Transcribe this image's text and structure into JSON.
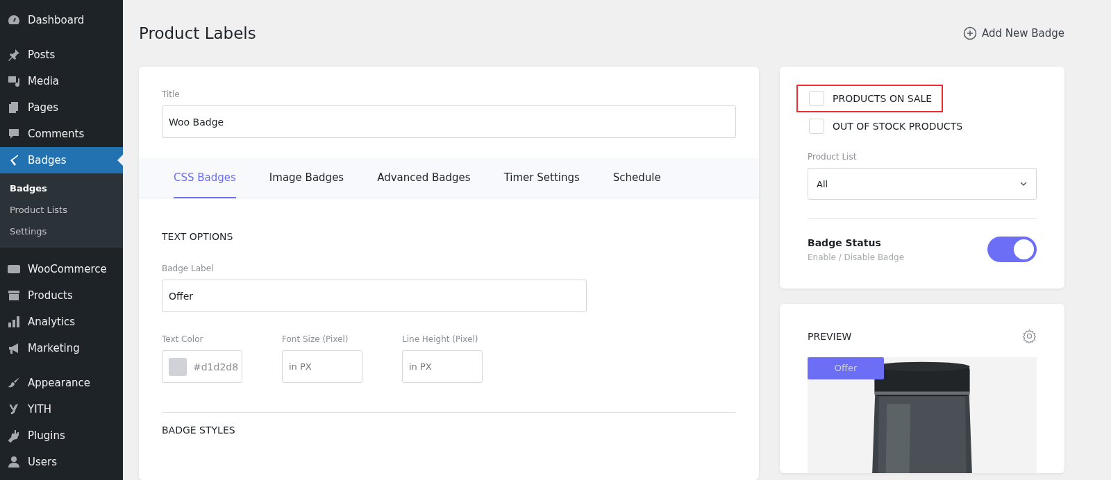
{
  "sidebar": {
    "groups": [
      [
        {
          "label": "Dashboard",
          "selected": false
        }
      ],
      [
        {
          "label": "Posts",
          "selected": false
        },
        {
          "label": "Media",
          "selected": false
        },
        {
          "label": "Pages",
          "selected": false
        },
        {
          "label": "Comments",
          "selected": false
        },
        {
          "label": "Badges",
          "selected": true,
          "submenu": [
            {
              "label": "Badges",
              "selected": true
            },
            {
              "label": "Product Lists",
              "selected": false
            },
            {
              "label": "Settings",
              "selected": false
            }
          ]
        }
      ],
      [
        {
          "label": "WooCommerce",
          "selected": false
        },
        {
          "label": "Products",
          "selected": false
        },
        {
          "label": "Analytics",
          "selected": false
        },
        {
          "label": "Marketing",
          "selected": false
        }
      ],
      [
        {
          "label": "Appearance",
          "selected": false
        },
        {
          "label": "YITH",
          "selected": false
        },
        {
          "label": "Plugins",
          "selected": false
        },
        {
          "label": "Users",
          "selected": false
        }
      ]
    ]
  },
  "page": {
    "title": "Product Labels",
    "action": "Add New Badge"
  },
  "editor": {
    "title_label": "Title",
    "title_value": "Woo Badge",
    "tabs": [
      {
        "label": "CSS Badges",
        "selected": true
      },
      {
        "label": "Image Badges",
        "selected": false
      },
      {
        "label": "Advanced Badges",
        "selected": false
      },
      {
        "label": "Timer Settings",
        "selected": false
      },
      {
        "label": "Schedule",
        "selected": false
      }
    ],
    "text_options": {
      "heading": "TEXT OPTIONS",
      "badge_label": "Badge Label",
      "badge_value": "Offer",
      "text_color_label": "Text Color",
      "text_color": "#d1d2d8",
      "font_size_label": "Font Size (Pixel)",
      "font_size_placeholder": "in PX",
      "line_height_label": "Line Height (Pixel)",
      "line_height_placeholder": "in PX"
    },
    "badge_styles_heading": "BADGE STYLES"
  },
  "settings": {
    "options": [
      {
        "label": "PRODUCTS ON SALE",
        "checked": false,
        "highlighted": true
      },
      {
        "label": "OUT OF STOCK PRODUCTS",
        "checked": false,
        "highlighted": false
      }
    ],
    "product_list_label": "Product List",
    "product_list_value": "All",
    "status_title": "Badge Status",
    "status_hint": "Enable / Disable Badge",
    "status_on": true
  },
  "preview": {
    "heading": "PREVIEW",
    "badge": "Offer"
  }
}
